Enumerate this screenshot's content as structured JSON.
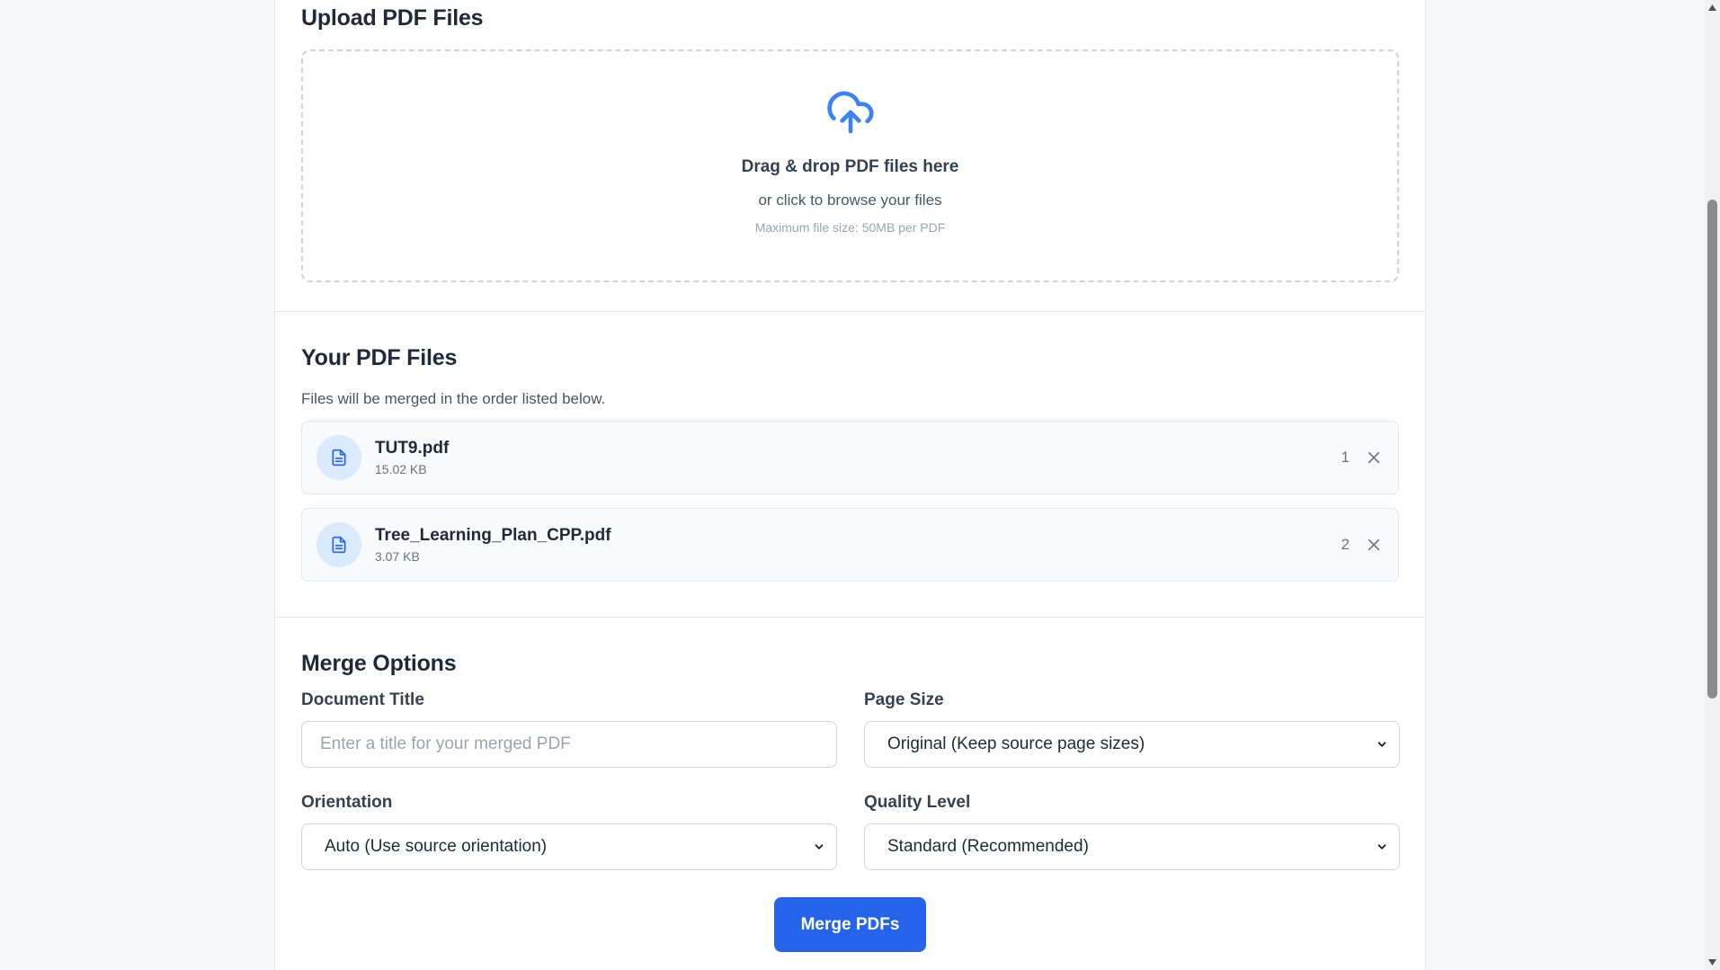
{
  "upload": {
    "heading": "Upload PDF Files",
    "drop_title": "Drag & drop PDF files here",
    "drop_subtitle": "or click to browse your files",
    "drop_hint": "Maximum file size: 50MB per PDF",
    "icon": "cloud-upload-icon"
  },
  "files": {
    "heading": "Your PDF Files",
    "description": "Files will be merged in the order listed below.",
    "items": [
      {
        "name": "TUT9.pdf",
        "size": "15.02 KB",
        "order": "1"
      },
      {
        "name": "Tree_Learning_Plan_CPP.pdf",
        "size": "3.07 KB",
        "order": "2"
      }
    ]
  },
  "options": {
    "heading": "Merge Options",
    "title_label": "Document Title",
    "title_placeholder": "Enter a title for your merged PDF",
    "page_size_label": "Page Size",
    "page_size_value": "Original (Keep source page sizes)",
    "orientation_label": "Orientation",
    "orientation_value": "Auto (Use source orientation)",
    "quality_label": "Quality Level",
    "quality_value": "Standard (Recommended)"
  },
  "actions": {
    "merge_label": "Merge PDFs"
  },
  "colors": {
    "accent": "#2563eb",
    "icon_blue": "#3b82f6",
    "file_icon_bg": "#dbeafe"
  }
}
